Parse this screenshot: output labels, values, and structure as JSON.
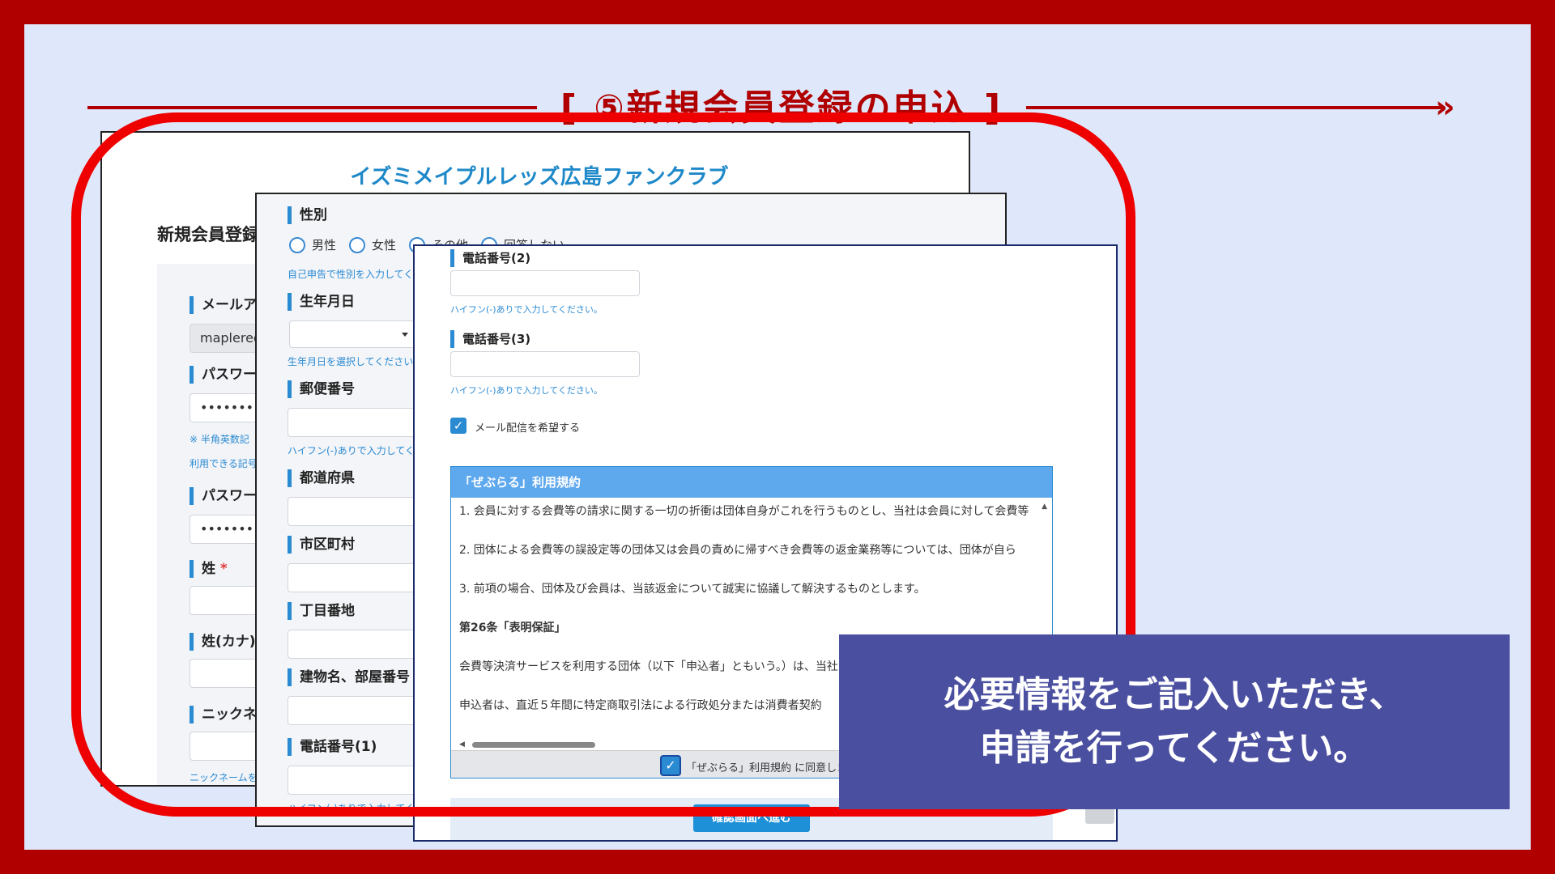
{
  "heading": {
    "bracket_left": "[",
    "title": "⑤新規会員登録の申込",
    "bracket_right": "]",
    "arrow": "»"
  },
  "screen1": {
    "site_title": "イズミメイプルレッズ広島ファンクラブサイト",
    "subtitle": "新規会員登録",
    "fields": {
      "email_label": "メールアドレス",
      "email_value": "maplered",
      "password_label": "パスワード",
      "password_value": "•••••••••••",
      "password_hint1": "※ 半角英数記",
      "password_hint2": "利用できる記号",
      "password_confirm_label": "パスワード",
      "password_confirm_value": "•••••••••••",
      "surname_label": "姓",
      "surname_kana_label": "姓(カナ)",
      "required_mark": "*",
      "nickname_label": "ニックネー",
      "nickname_hint": "ニックネームを登"
    }
  },
  "screen2": {
    "gender_label": "性別",
    "gender_options": [
      "男性",
      "女性",
      "その他",
      "回答しない"
    ],
    "gender_hint": "自己申告で性別を入力してく",
    "birthday_label": "生年月日",
    "birthday_hint": "生年月日を選択してください",
    "postal_label": "郵便番号",
    "postal_hint": "ハイフン(-)ありで入力してくださ",
    "prefecture_label": "都道府県",
    "city_label": "市区町村",
    "address_label": "丁目番地",
    "building_label": "建物名、部屋番号",
    "phone1_label": "電話番号(1)",
    "phone1_hint": "ハイフン(-)ありで入力してくださ"
  },
  "screen3": {
    "phone2_label": "電話番号(2)",
    "phone2_hint": "ハイフン(-)ありで入力してください。",
    "phone3_label": "電話番号(3)",
    "phone3_hint": "ハイフン(-)ありで入力してください。",
    "newsletter_label": "メール配信を希望する",
    "newsletter_checked": true,
    "terms": {
      "header": "「ぜぶらる」利用規約",
      "lines": [
        "1. 会員に対する会費等の請求に関する一切の折衝は団体自身がこれを行うものとし、当社は会員に対して会費等",
        "2. 団体による会費等の誤設定等の団体又は会員の責めに帰すべき会費等の返金業務等については、団体が自ら",
        "3. 前項の場合、団体及び会員は、当該返金について誠実に協議して解決するものとします。",
        "第26条「表明保証」",
        "会費等決済サービスを利用する団体（以下「申込者」ともいう。）は、当社",
        "申込者は、直近５年間に特定商取引法による行政処分または消費者契約"
      ],
      "agree_label": "「ぜぶらる」利用規約 に同意します",
      "agree_checked": true
    },
    "confirm_button": "確認画面へ進む"
  },
  "callout": {
    "line1": "必要情報をご記入いただき、",
    "line2": "申請を行ってください。"
  },
  "colors": {
    "border_red": "#b00000",
    "outline_red": "#ee0000",
    "background": "#dfe8fb",
    "callout_bg": "#4a4fa0",
    "accent_blue": "#2a8ad2"
  }
}
